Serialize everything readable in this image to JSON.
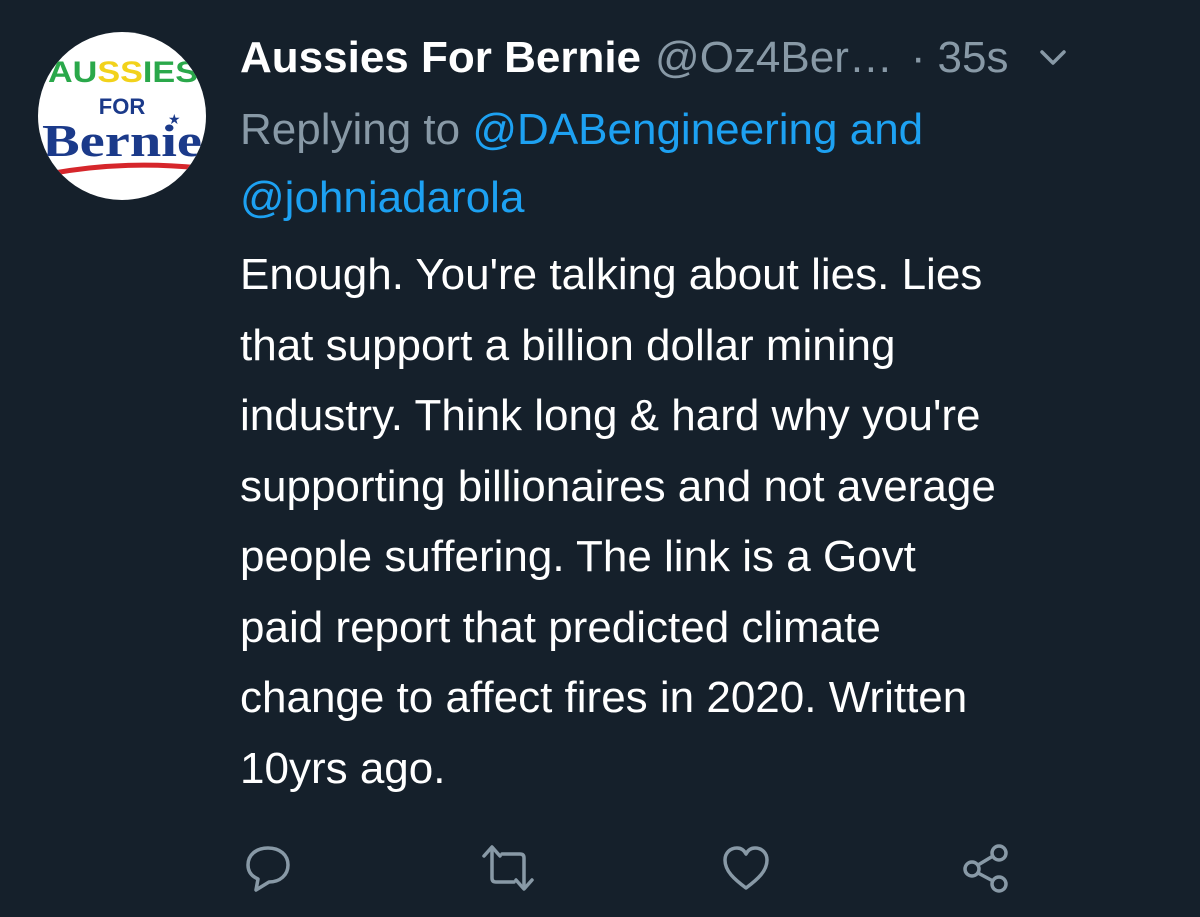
{
  "tweet": {
    "display_name": "Aussies For Bernie",
    "handle": "@Oz4Ber…",
    "separator": "·",
    "time": "35s",
    "avatar": {
      "line1": "AUSSIES",
      "line2": "FOR",
      "line3": "Bernie"
    },
    "reply": {
      "prefix": "Replying to",
      "mention1": "@DABengineering",
      "conjunction": "and",
      "mention2": "@johniadarola"
    },
    "text_lines": [
      "Enough. You're talking about lies. Lies",
      "that support a billion dollar mining",
      "industry. Think long & hard why you're",
      "supporting billionaires and not average",
      "people suffering. The link is a Govt",
      "paid report that predicted climate",
      "change to affect fires in 2020. Written",
      "10yrs ago."
    ]
  },
  "actions": [
    {
      "name": "reply",
      "icon": "reply-icon"
    },
    {
      "name": "retweet",
      "icon": "retweet-icon"
    },
    {
      "name": "like",
      "icon": "heart-icon"
    },
    {
      "name": "share",
      "icon": "share-icon"
    }
  ],
  "colors": {
    "background": "#15202b",
    "muted": "#8899a6",
    "link": "#1da1f2",
    "text": "#ffffff"
  }
}
